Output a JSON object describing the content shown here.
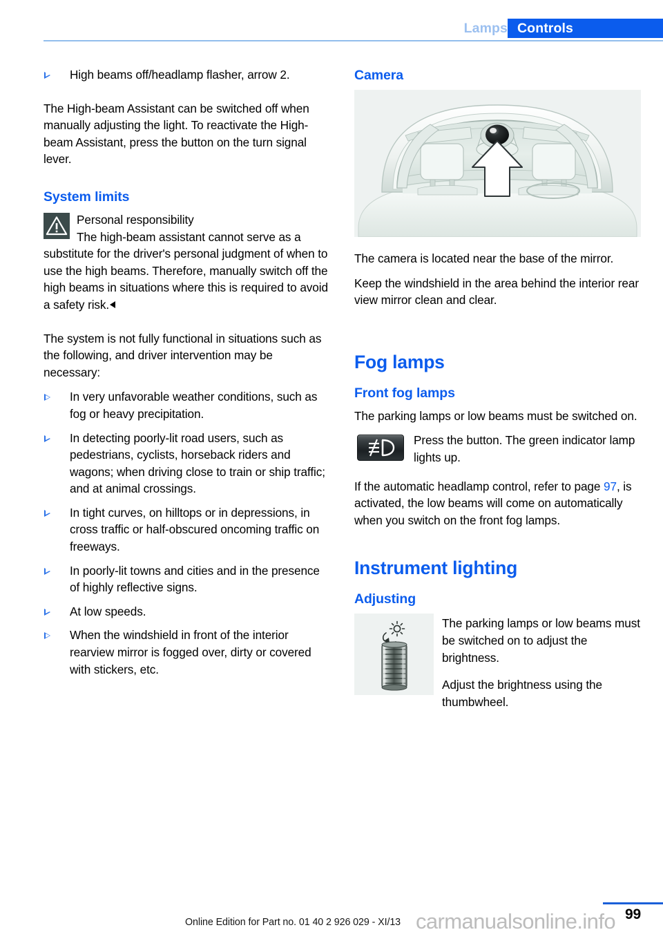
{
  "header": {
    "chapter": "Lamps",
    "section": "Controls",
    "accent_color": "#0b5ced",
    "chapter_color": "#9cc0f0"
  },
  "left_column": {
    "intro_bullet": "High beams off/headlamp flasher, arrow 2.",
    "paragraph_1": "The High-beam Assistant can be switched off when manually adjusting the light. To reactivate the High-beam Assistant, press the button on the turn signal lever.",
    "system_limits_heading": "System limits",
    "warning": {
      "icon": "warning-triangle-icon",
      "title": "Personal responsibility",
      "body": "The high-beam assistant cannot serve as a substitute for the driver's personal judgment of when to use the high beams. Therefore, manually switch off the high beams in situations where this is required to avoid a safety risk."
    },
    "paragraph_2": "The system is not fully functional in situations such as the following, and driver intervention may be necessary:",
    "limits_list": [
      "In very unfavorable weather conditions, such as fog or heavy precipitation.",
      "In detecting poorly-lit road users, such as pedestrians, cyclists, horseback riders and wagons; when driving close to train or ship traffic; and at animal crossings.",
      "In tight curves, on hilltops or in depressions, in cross traffic or half-obscured oncoming traffic on freeways.",
      "In poorly-lit towns and cities and in the presence of highly reflective signs.",
      "At low speeds.",
      "When the windshield in front of the interior rearview mirror is fogged over, dirty or covered with stickers, etc."
    ]
  },
  "right_column": {
    "camera_heading": "Camera",
    "camera_figure_name": "windshield-camera-illustration",
    "camera_text_1": "The camera is located near the base of the mirror.",
    "camera_text_2": "Keep the windshield in the area behind the interior rear view mirror clean and clear.",
    "fog_lamps_heading": "Fog lamps",
    "front_fog_heading": "Front fog lamps",
    "front_fog_text": "The parking lamps or low beams must be switched on.",
    "fog_button_icon": "front-fog-lamp-button-icon",
    "fog_button_text": "Press the button. The green indicator lamp lights up.",
    "auto_headlamp_text_before": "If the automatic headlamp control, refer to page ",
    "auto_headlamp_page_ref": "97",
    "auto_headlamp_text_after": ", is activated, the low beams will come on automatically when you switch on the front fog lamps.",
    "instrument_lighting_heading": "Instrument lighting",
    "adjusting_heading": "Adjusting",
    "thumbwheel_figure_name": "instrument-lighting-thumbwheel-illustration",
    "thumbwheel_text_1": "The parking lamps or low beams must be switched on to adjust the brightness.",
    "thumbwheel_text_2": "Adjust the brightness using the thumbwheel."
  },
  "footer": {
    "edition": "Online Edition for Part no. 01 40 2 926 029 - XI/13",
    "watermark": "carmanualsonline.info",
    "page_number": "99"
  }
}
